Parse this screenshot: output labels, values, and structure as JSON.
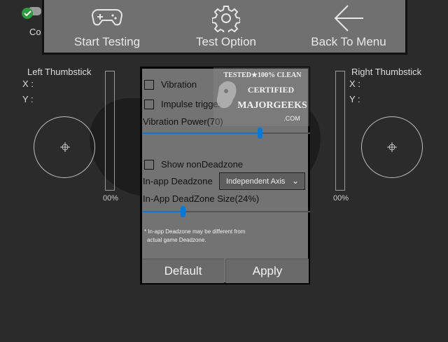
{
  "status": {
    "label": "Controller connected",
    "icon": "controller-check-icon",
    "visible_label": "Co"
  },
  "toolbar": {
    "start_label": "Start Testing",
    "option_label": "Test Option",
    "back_label": "Back To Menu"
  },
  "left_stick": {
    "title": "Left Thumbstick",
    "x_label": "X :",
    "y_label": "Y :",
    "trigger_pct": "00%"
  },
  "right_stick": {
    "title": "Right Thumbstick",
    "x_label": "X :",
    "y_label": "Y :",
    "trigger_pct": "00%"
  },
  "panel": {
    "vibration_label": "Vibration",
    "impulse_label": "Impulse trigger",
    "vibration_power_label": "Vibration Power(70)",
    "vibration_power_value": 0.7,
    "show_deadzone_label": "Show nonDeadzone",
    "deadzone_label": "In-app Deadzone",
    "deadzone_mode": "Independent Axis",
    "deadzone_size_label": "In-App DeadZone Size(24%)",
    "deadzone_size_value": 0.24,
    "note_line1": "* In-app Deadzone may be different from",
    "note_line2": "actual game Deadzone.",
    "default_label": "Default",
    "apply_label": "Apply"
  },
  "watermark": {
    "line1": "TESTED★100% CLEAN",
    "line2": "CERTIFIED",
    "line3": "MAJORGEEKS",
    "line4": ".COM"
  },
  "colors": {
    "accent": "#0a78d4",
    "panel": "#737373",
    "background": "#2b2b2b"
  }
}
